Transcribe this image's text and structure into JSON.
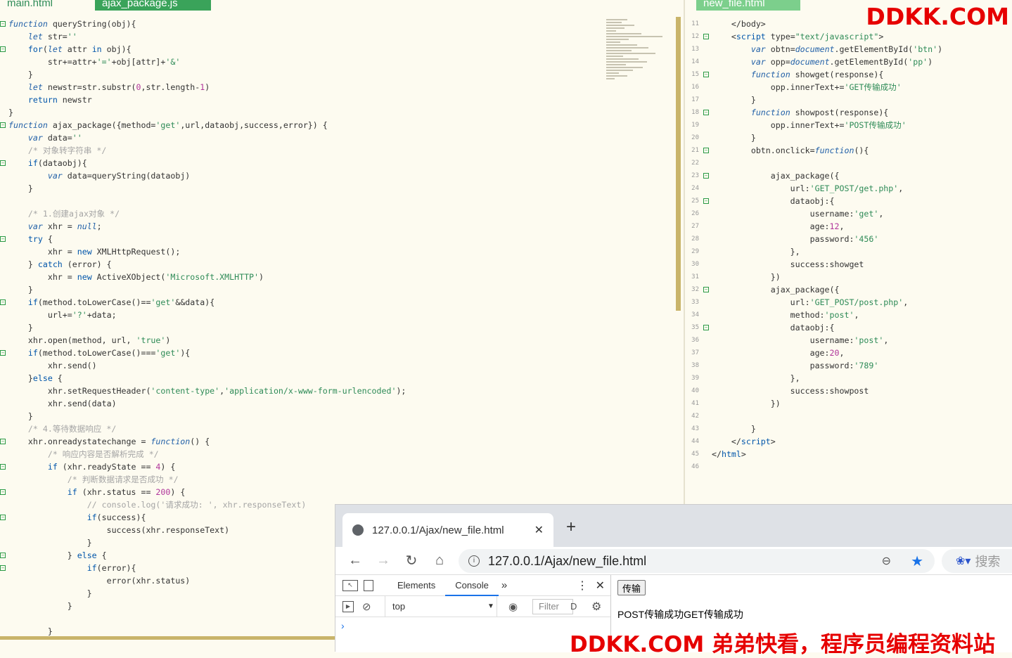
{
  "left_editor": {
    "tabs": [
      "main.html",
      "ajax_package.js"
    ],
    "active_tab": 1,
    "lines": [
      {
        "f": 1,
        "h": "<span class='kw'>function</span> queryString(obj){"
      },
      {
        "f": 0,
        "h": "    <span class='kw'>let</span> str=<span class='st'>''</span>"
      },
      {
        "f": 1,
        "h": "    <span class='kw2'>for</span>(<span class='kw'>let</span> attr <span class='kw2'>in</span> obj){"
      },
      {
        "f": 0,
        "h": "        str+=attr+<span class='st'>'='</span>+obj[attr]+<span class='st'>'&amp;'</span>"
      },
      {
        "f": 0,
        "h": "    }"
      },
      {
        "f": 0,
        "h": "    <span class='kw'>let</span> newstr=str.substr(<span class='nm'>0</span>,str.length-<span class='nm'>1</span>)"
      },
      {
        "f": 0,
        "h": "    <span class='kw2'>return</span> newstr"
      },
      {
        "f": 0,
        "h": "}"
      },
      {
        "f": 1,
        "h": "<span class='kw'>function</span> ajax_package({method=<span class='st'>'get'</span>,url,dataobj,success,error}) {"
      },
      {
        "f": 0,
        "h": "    <span class='kw'>var</span> data=<span class='st'>''</span>"
      },
      {
        "f": 0,
        "h": "    <span class='cm'>/* 对象转字符串 */</span>"
      },
      {
        "f": 1,
        "h": "    <span class='kw2'>if</span>(dataobj){"
      },
      {
        "f": 0,
        "h": "        <span class='kw'>var</span> data=queryString(dataobj)"
      },
      {
        "f": 0,
        "h": "    }"
      },
      {
        "f": 0,
        "h": ""
      },
      {
        "f": 0,
        "h": "    <span class='cm'>/* 1.创建ajax对象 */</span>"
      },
      {
        "f": 0,
        "h": "    <span class='kw'>var</span> xhr = <span class='kw'>null</span>;"
      },
      {
        "f": 1,
        "h": "    <span class='kw2'>try</span> {"
      },
      {
        "f": 0,
        "h": "        xhr = <span class='kw2'>new</span> XMLHttpRequest();"
      },
      {
        "f": 0,
        "h": "    } <span class='kw2'>catch</span> (error) {"
      },
      {
        "f": 0,
        "h": "        xhr = <span class='kw2'>new</span> ActiveXObject(<span class='st'>'Microsoft.XMLHTTP'</span>)"
      },
      {
        "f": 0,
        "h": "    }"
      },
      {
        "f": 1,
        "h": "    <span class='kw2'>if</span>(method.toLowerCase()==<span class='st'>'get'</span>&amp;&amp;data){"
      },
      {
        "f": 0,
        "h": "        url+=<span class='st'>'?'</span>+data;"
      },
      {
        "f": 0,
        "h": "    }"
      },
      {
        "f": 0,
        "h": "    xhr.open(method, url, <span class='st'>'true'</span>)"
      },
      {
        "f": 1,
        "h": "    <span class='kw2'>if</span>(method.toLowerCase()===<span class='st'>'get'</span>){"
      },
      {
        "f": 0,
        "h": "        xhr.send()"
      },
      {
        "f": 0,
        "h": "    }<span class='kw2'>else</span> {"
      },
      {
        "f": 0,
        "h": "        xhr.setRequestHeader(<span class='st'>'content-type'</span>,<span class='st'>'application/x-www-form-urlencoded'</span>);"
      },
      {
        "f": 0,
        "h": "        xhr.send(data)"
      },
      {
        "f": 0,
        "h": "    }"
      },
      {
        "f": 0,
        "h": "    <span class='cm'>/* 4.等待数据响应 */</span>"
      },
      {
        "f": 1,
        "h": "    xhr.onreadystatechange = <span class='kw'>function</span>() {"
      },
      {
        "f": 0,
        "h": "        <span class='cm'>/* 响应内容是否解析完成 */</span>"
      },
      {
        "f": 1,
        "h": "        <span class='kw2'>if</span> (xhr.readyState == <span class='nm'>4</span>) {"
      },
      {
        "f": 0,
        "h": "            <span class='cm'>/* 判断数据请求是否成功 */</span>"
      },
      {
        "f": 1,
        "h": "            <span class='kw2'>if</span> (xhr.status == <span class='nm'>200</span>) {"
      },
      {
        "f": 0,
        "h": "                <span class='cm'>// console.log('请求成功: ', xhr.responseText)</span>"
      },
      {
        "f": 1,
        "h": "                <span class='kw2'>if</span>(success){"
      },
      {
        "f": 0,
        "h": "                    success(xhr.responseText)"
      },
      {
        "f": 0,
        "h": "                }"
      },
      {
        "f": 1,
        "h": "            } <span class='kw2'>else</span> {"
      },
      {
        "f": 1,
        "h": "                <span class='kw2'>if</span>(error){"
      },
      {
        "f": 0,
        "h": "                    error(xhr.status)"
      },
      {
        "f": 0,
        "h": "                }"
      },
      {
        "f": 0,
        "h": "            }"
      },
      {
        "f": 0,
        "h": ""
      },
      {
        "f": 0,
        "h": "        }"
      }
    ]
  },
  "right_editor": {
    "tabs": [
      "new_file.html"
    ],
    "lines": [
      {
        "n": "11",
        "f": 0,
        "h": "    &lt;/body&gt;"
      },
      {
        "n": "12",
        "f": 1,
        "h": "    &lt;<span class='kw2'>script</span> type=<span class='st'>\"text/javascript\"</span>&gt;"
      },
      {
        "n": "13",
        "f": 0,
        "h": "        <span class='kw'>var</span> obtn=<span class='kw'>document</span>.getElementById(<span class='st'>'btn'</span>)"
      },
      {
        "n": "14",
        "f": 0,
        "h": "        <span class='kw'>var</span> opp=<span class='kw'>document</span>.getElementById(<span class='st'>'pp'</span>)"
      },
      {
        "n": "15",
        "f": 1,
        "h": "        <span class='kw'>function</span> showget(response){"
      },
      {
        "n": "16",
        "f": 0,
        "h": "            opp.innerText+=<span class='st'>'GET传输成功'</span>"
      },
      {
        "n": "17",
        "f": 0,
        "h": "        }"
      },
      {
        "n": "18",
        "f": 1,
        "h": "        <span class='kw'>function</span> showpost(response){"
      },
      {
        "n": "19",
        "f": 0,
        "h": "            opp.innerText+=<span class='st'>'POST传输成功'</span>"
      },
      {
        "n": "20",
        "f": 0,
        "h": "        }"
      },
      {
        "n": "21",
        "f": 1,
        "h": "        obtn.onclick=<span class='kw'>function</span>(){"
      },
      {
        "n": "22",
        "f": 0,
        "h": ""
      },
      {
        "n": "23",
        "f": 1,
        "h": "            ajax_package({"
      },
      {
        "n": "24",
        "f": 0,
        "h": "                url:<span class='st'>'GET_POST/get.php'</span>,"
      },
      {
        "n": "25",
        "f": 1,
        "h": "                dataobj:{"
      },
      {
        "n": "26",
        "f": 0,
        "h": "                    username:<span class='st'>'get'</span>,"
      },
      {
        "n": "27",
        "f": 0,
        "h": "                    age:<span class='nm'>12</span>,"
      },
      {
        "n": "28",
        "f": 0,
        "h": "                    password:<span class='st'>'456'</span>"
      },
      {
        "n": "29",
        "f": 0,
        "h": "                },"
      },
      {
        "n": "30",
        "f": 0,
        "h": "                success:showget"
      },
      {
        "n": "31",
        "f": 0,
        "h": "            })"
      },
      {
        "n": "32",
        "f": 1,
        "h": "            ajax_package({"
      },
      {
        "n": "33",
        "f": 0,
        "h": "                url:<span class='st'>'GET_POST/post.php'</span>,"
      },
      {
        "n": "34",
        "f": 0,
        "h": "                method:<span class='st'>'post'</span>,"
      },
      {
        "n": "35",
        "f": 1,
        "h": "                dataobj:{"
      },
      {
        "n": "36",
        "f": 0,
        "h": "                    username:<span class='st'>'post'</span>,"
      },
      {
        "n": "37",
        "f": 0,
        "h": "                    age:<span class='nm'>20</span>,"
      },
      {
        "n": "38",
        "f": 0,
        "h": "                    password:<span class='st'>'789'</span>"
      },
      {
        "n": "39",
        "f": 0,
        "h": "                },"
      },
      {
        "n": "40",
        "f": 0,
        "h": "                success:showpost"
      },
      {
        "n": "41",
        "f": 0,
        "h": "            })"
      },
      {
        "n": "42",
        "f": 0,
        "h": ""
      },
      {
        "n": "43",
        "f": 0,
        "h": "        }"
      },
      {
        "n": "44",
        "f": 0,
        "h": "    &lt;/<span class='kw2'>script</span>&gt;"
      },
      {
        "n": "45",
        "f": 0,
        "h": "&lt;/<span class='kw2'>html</span>&gt;"
      },
      {
        "n": "46",
        "f": 0,
        "h": ""
      }
    ]
  },
  "browser": {
    "tab_title": "127.0.0.1/Ajax/new_file.html",
    "tab_close": "✕",
    "new_tab": "+",
    "url": "127.0.0.1/Ajax/new_file.html",
    "search_placeholder": "搜索",
    "devtools": {
      "tabs": [
        "Elements",
        "Console"
      ],
      "selected": "Console",
      "more": "»",
      "context": "top",
      "filter_placeholder": "Filter",
      "levels": "D",
      "prompt": "›"
    },
    "page": {
      "button_label": "传输",
      "output": "POST传输成功GET传输成功"
    }
  },
  "watermark": {
    "top": "DDKK.COM",
    "bottom": "DDKK.COM 弟弟快看，程序员编程资料站"
  },
  "colors": {
    "editor_bg": "#fdfbf0",
    "accent_green": "#3aa35a",
    "watermark": "#e60000",
    "scrollbar": "#c9b46a"
  }
}
